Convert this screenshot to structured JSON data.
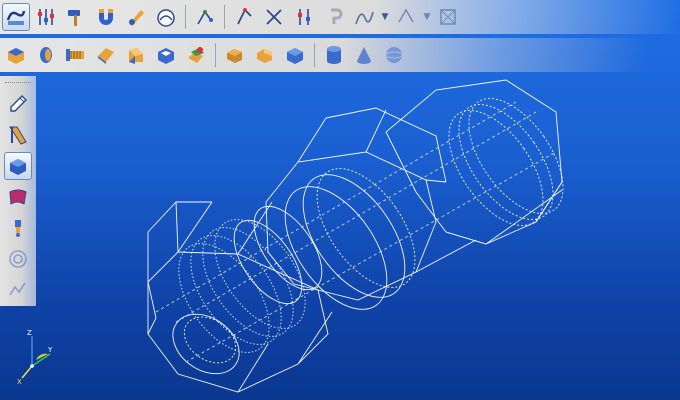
{
  "window": {
    "title": ""
  },
  "colors": {
    "viewport_top": "#1f6fe6",
    "viewport_bottom": "#0a3890",
    "wireframe": "#ffffff",
    "toolbar": "#dcdcdc",
    "accent_blue": "#2a5fc0",
    "accent_orange": "#e8a23a"
  },
  "toolbar_top": {
    "buttons": [
      {
        "name": "sketch-mode-button",
        "icon": "sketch-icon",
        "active": true
      },
      {
        "name": "parameters-button",
        "icon": "sliders-icon"
      },
      {
        "name": "hammer-tool-button",
        "icon": "hammer-icon"
      },
      {
        "name": "magnet-tool-button",
        "icon": "magnet-icon"
      },
      {
        "name": "edit-feature-button",
        "icon": "pencil-hand-icon"
      },
      {
        "name": "view-orient-button",
        "icon": "gauge-icon"
      },
      {
        "name": "constraint-button",
        "icon": "constraint-icon"
      },
      {
        "name": "relation-button",
        "icon": "relation-icon"
      },
      {
        "name": "trim-button",
        "icon": "trim-icon"
      },
      {
        "name": "dimension-button",
        "icon": "dimension-sliders-icon"
      },
      {
        "name": "hook-button",
        "icon": "hook-icon"
      },
      {
        "name": "curve-button",
        "icon": "curve-icon"
      },
      {
        "name": "pattern-button",
        "icon": "pattern-icon"
      },
      {
        "name": "fit-view-button",
        "icon": "fit-icon"
      }
    ]
  },
  "toolbar_second": {
    "buttons": [
      {
        "name": "extrude-button",
        "icon": "extrude-icon"
      },
      {
        "name": "revolve-button",
        "icon": "revolve-icon"
      },
      {
        "name": "thread-button",
        "icon": "thread-icon"
      },
      {
        "name": "sweep-button",
        "icon": "sweep-icon"
      },
      {
        "name": "loft-button",
        "icon": "loft-icon"
      },
      {
        "name": "shell-button",
        "icon": "shell-icon"
      },
      {
        "name": "fillet-button",
        "icon": "fillet-icon"
      },
      {
        "name": "chamfer-button",
        "icon": "chamfer-icon"
      },
      {
        "name": "boolean-button",
        "icon": "boolean-icon"
      },
      {
        "name": "box-primitive-button",
        "icon": "box-icon"
      },
      {
        "name": "cylinder-primitive-button",
        "icon": "cylinder-icon"
      },
      {
        "name": "cone-primitive-button",
        "icon": "cone-icon"
      },
      {
        "name": "sphere-primitive-button",
        "icon": "sphere-icon"
      }
    ]
  },
  "left_toolbar": {
    "buttons": [
      {
        "name": "sketch-tool-button",
        "icon": "pencil-icon"
      },
      {
        "name": "design-tool-button",
        "icon": "ruler-pencil-icon"
      },
      {
        "name": "solid-tool-button",
        "icon": "solid-cube-icon",
        "active": true
      },
      {
        "name": "surface-tool-button",
        "icon": "surface-icon"
      },
      {
        "name": "assembly-tool-button",
        "icon": "assembly-icon"
      },
      {
        "name": "render-tool-button",
        "icon": "target-icon",
        "faded": true
      },
      {
        "name": "analysis-tool-button",
        "icon": "analysis-icon",
        "faded": true
      }
    ]
  },
  "triad": {
    "x_label": "X",
    "y_label": "Y",
    "z_label": "Z"
  }
}
